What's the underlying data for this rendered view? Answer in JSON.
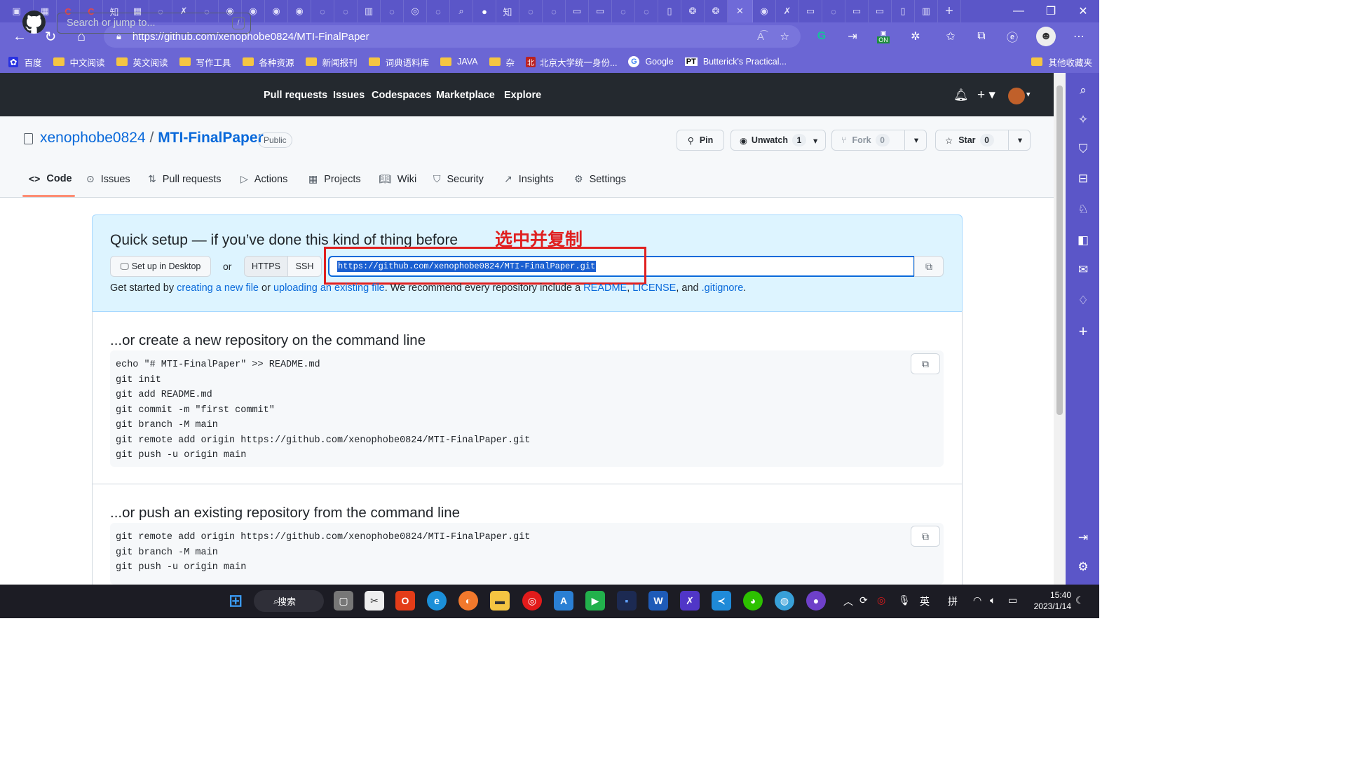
{
  "browser": {
    "url": "https://github.com/xenophobe0824/MTI-FinalPaper",
    "tabs": [
      "知",
      "知",
      "知"
    ],
    "window_controls": {
      "minimize": "—",
      "restore": "❐",
      "close": "✕"
    },
    "ext_on_label": "ON"
  },
  "bookmarks": [
    {
      "label": "百度",
      "type": "site"
    },
    {
      "label": "中文阅读",
      "type": "folder"
    },
    {
      "label": "英文阅读",
      "type": "folder"
    },
    {
      "label": "写作工具",
      "type": "folder"
    },
    {
      "label": "各种资源",
      "type": "folder"
    },
    {
      "label": "新闻报刊",
      "type": "folder"
    },
    {
      "label": "词典语料库",
      "type": "folder"
    },
    {
      "label": "JAVA",
      "type": "folder"
    },
    {
      "label": "杂",
      "type": "folder"
    },
    {
      "label": "北京大学统一身份...",
      "type": "site"
    },
    {
      "label": "Google",
      "type": "site"
    },
    {
      "label": "Butterick's Practical...",
      "type": "site"
    }
  ],
  "bookmarks_other": "其他收藏夹",
  "github": {
    "search_placeholder": "Search or jump to...",
    "search_key": "/",
    "nav": [
      "Pull requests",
      "Issues",
      "Codespaces",
      "Marketplace",
      "Explore"
    ]
  },
  "repo": {
    "owner": "xenophobe0824",
    "separator": "/",
    "name": "MTI-FinalPaper",
    "visibility": "Public",
    "pin_label": "Pin",
    "watch_label": "Unwatch",
    "watch_count": "1",
    "fork_label": "Fork",
    "fork_count": "0",
    "star_label": "Star",
    "star_count": "0",
    "tabs": [
      "Code",
      "Issues",
      "Pull requests",
      "Actions",
      "Projects",
      "Wiki",
      "Security",
      "Insights",
      "Settings"
    ],
    "active_tab": "Code"
  },
  "quick_setup": {
    "title": "Quick setup — if you’ve done this kind of thing before",
    "desktop_button": "Set up in Desktop",
    "or_text": "or",
    "https_label": "HTTPS",
    "ssh_label": "SSH",
    "clone_url": "https://github.com/xenophobe0824/MTI-FinalPaper.git",
    "annotation": "选中并复制",
    "get_started": {
      "t1": "Get started by ",
      "link1": "creating a new file",
      "t2": " or ",
      "link2": "uploading an existing file",
      "t3": ". We recommend every repository include a ",
      "link3": "README",
      "t4": ", ",
      "link4": "LICENSE",
      "t5": ", and ",
      "link5": ".gitignore",
      "t6": "."
    }
  },
  "section_new": {
    "title": "...or create a new repository on the command line",
    "code": "echo \"# MTI-FinalPaper\" >> README.md\ngit init\ngit add README.md\ngit commit -m \"first commit\"\ngit branch -M main\ngit remote add origin https://github.com/xenophobe0824/MTI-FinalPaper.git\ngit push -u origin main"
  },
  "section_push": {
    "title": "...or push an existing repository from the command line",
    "code": "git remote add origin https://github.com/xenophobe0824/MTI-FinalPaper.git\ngit branch -M main\ngit push -u origin main"
  },
  "taskbar": {
    "search_label": "搜索",
    "ime_lang": "英",
    "ime_mode": "拼",
    "time": "15:40",
    "date": "2023/1/14"
  },
  "colors": {
    "browser_chrome": "#5b56c8",
    "github_header": "#24292f",
    "link": "#0969da",
    "annotation": "#e02020",
    "tab_underline": "#fd8c73"
  }
}
